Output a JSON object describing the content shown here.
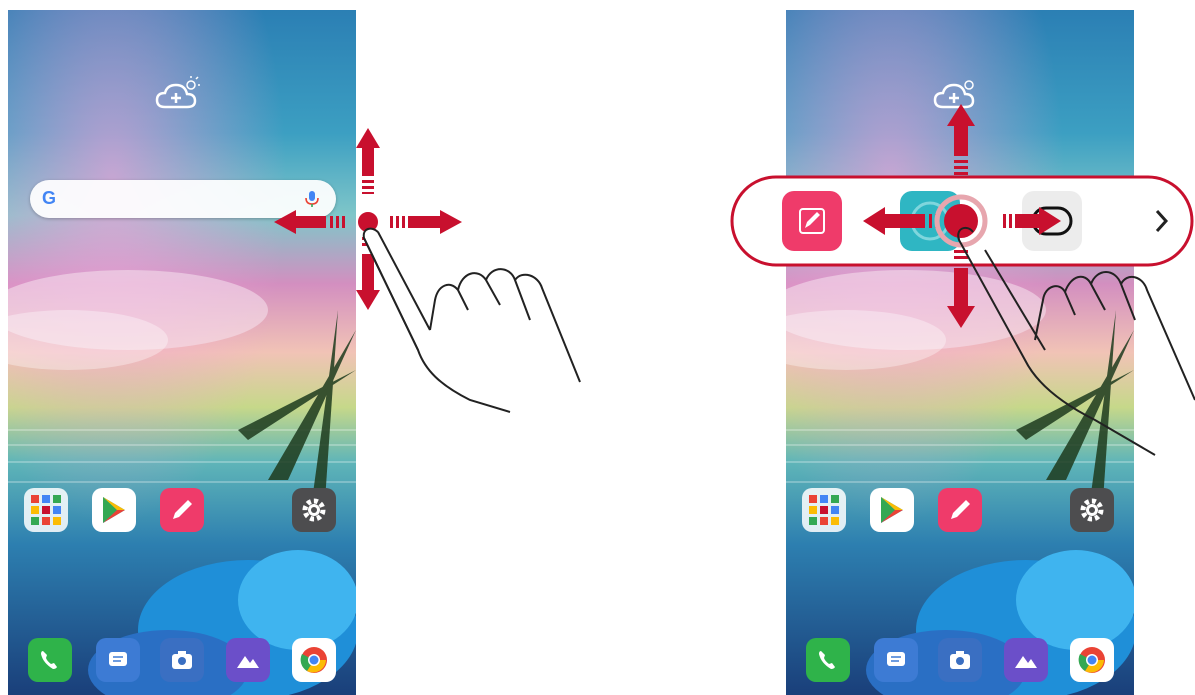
{
  "screens": [
    {
      "id": "left",
      "state": "home"
    },
    {
      "id": "right",
      "state": "app-switcher-open"
    }
  ],
  "search": {
    "logo": "G",
    "icon": "mic-icon"
  },
  "home_row": {
    "icons": [
      "folder-grid-icon",
      "play-store-icon",
      "notes-pencil-icon",
      "settings-gear-icon"
    ]
  },
  "dock": {
    "icons": [
      "phone-icon",
      "messages-icon",
      "camera-icon",
      "gallery-icon",
      "chrome-icon"
    ]
  },
  "switcher": {
    "items": [
      "qmemo-icon",
      "theme-icon",
      "toggle-icon"
    ],
    "more_icon": "chevron-right-icon"
  },
  "gesture": {
    "arrows": [
      "up",
      "down",
      "left",
      "right"
    ]
  },
  "colors": {
    "accent": "#c8102e",
    "switcher_bg": "#ffffff",
    "pencil_app": "#ef3b6a"
  }
}
